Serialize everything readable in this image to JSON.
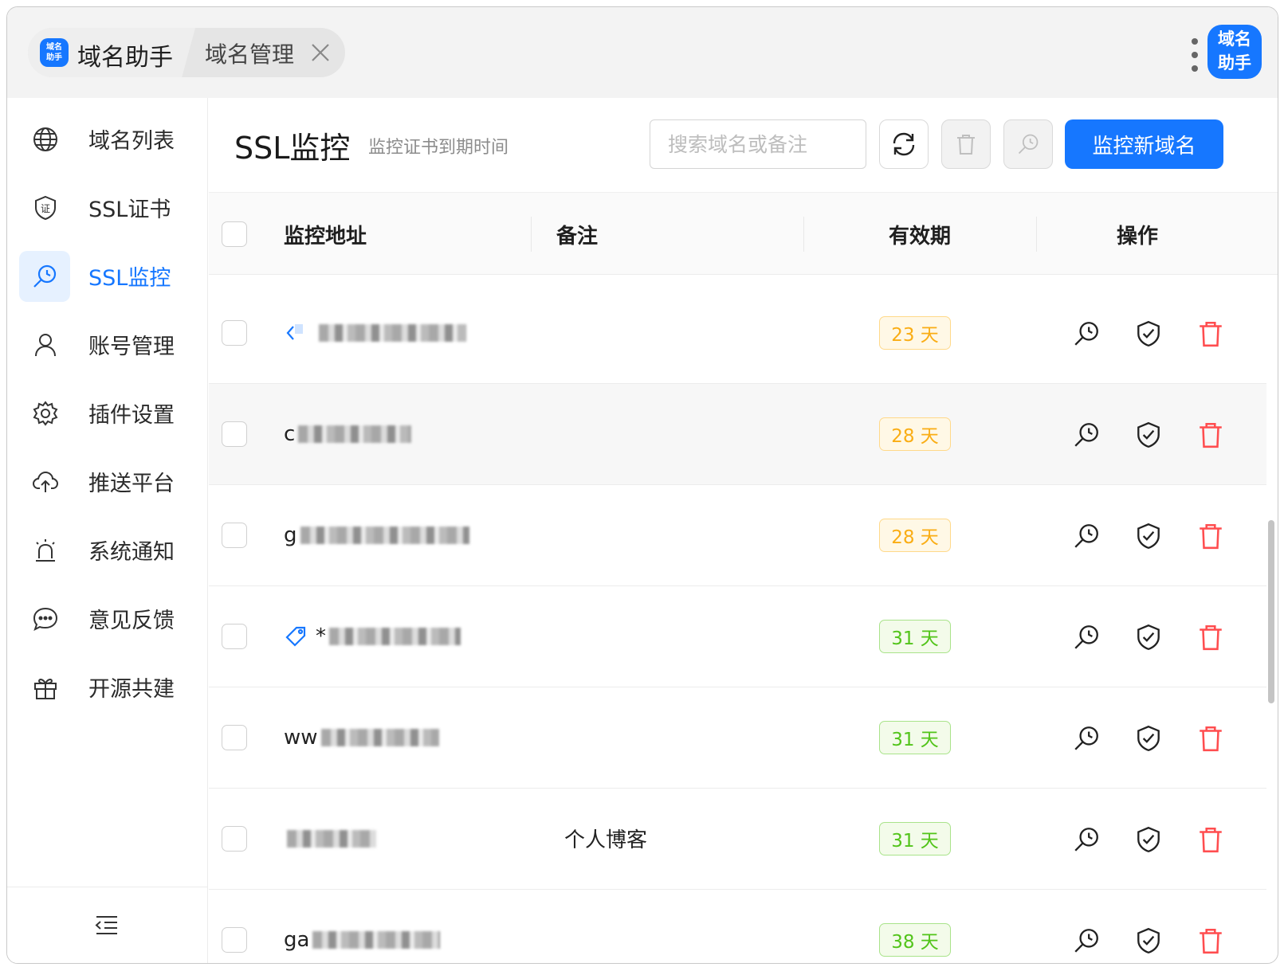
{
  "header": {
    "logo_text": "域名助手",
    "app_title": "域名助手",
    "tab_label": "域名管理",
    "avatar_text_line1": "域名",
    "avatar_text_line2": "助手"
  },
  "sidebar": {
    "items": [
      {
        "label": "域名列表",
        "icon": "globe-icon"
      },
      {
        "label": "SSL证书",
        "icon": "certificate-shield-icon"
      },
      {
        "label": "SSL监控",
        "icon": "ssl-monitor-search-icon",
        "active": true
      },
      {
        "label": "账号管理",
        "icon": "user-icon"
      },
      {
        "label": "插件设置",
        "icon": "gear-icon"
      },
      {
        "label": "推送平台",
        "icon": "cloud-upload-icon"
      },
      {
        "label": "系统通知",
        "icon": "alarm-icon"
      },
      {
        "label": "意见反馈",
        "icon": "chat-icon"
      },
      {
        "label": "开源共建",
        "icon": "gift-icon"
      }
    ]
  },
  "main": {
    "title": "SSL监控",
    "subtitle": "监控证书到期时间",
    "search_placeholder": "搜索域名或备注",
    "add_button": "监控新域名",
    "columns": {
      "address": "监控地址",
      "note": "备注",
      "validity": "有效期",
      "actions": "操作"
    },
    "rows": [
      {
        "prefix": "",
        "note": "",
        "days": "23 天",
        "status": "warn",
        "icon": "code-tag-icon"
      },
      {
        "prefix": "c",
        "note": "",
        "days": "28 天",
        "status": "warn",
        "icon": ""
      },
      {
        "prefix": "g",
        "note": "",
        "days": "28 天",
        "status": "warn",
        "icon": ""
      },
      {
        "prefix": "*",
        "note": "",
        "days": "31 天",
        "status": "ok",
        "icon": "price-tag-icon"
      },
      {
        "prefix": "ww",
        "note": "",
        "days": "31 天",
        "status": "ok",
        "icon": ""
      },
      {
        "prefix": "",
        "note": "个人博客",
        "days": "31 天",
        "status": "ok",
        "icon": ""
      },
      {
        "prefix": "ga",
        "note": "",
        "days": "38 天",
        "status": "ok",
        "icon": ""
      }
    ]
  },
  "colors": {
    "primary": "#1677ff",
    "warn": "#faad14",
    "ok": "#52c41a",
    "danger": "#ff4d4f"
  }
}
